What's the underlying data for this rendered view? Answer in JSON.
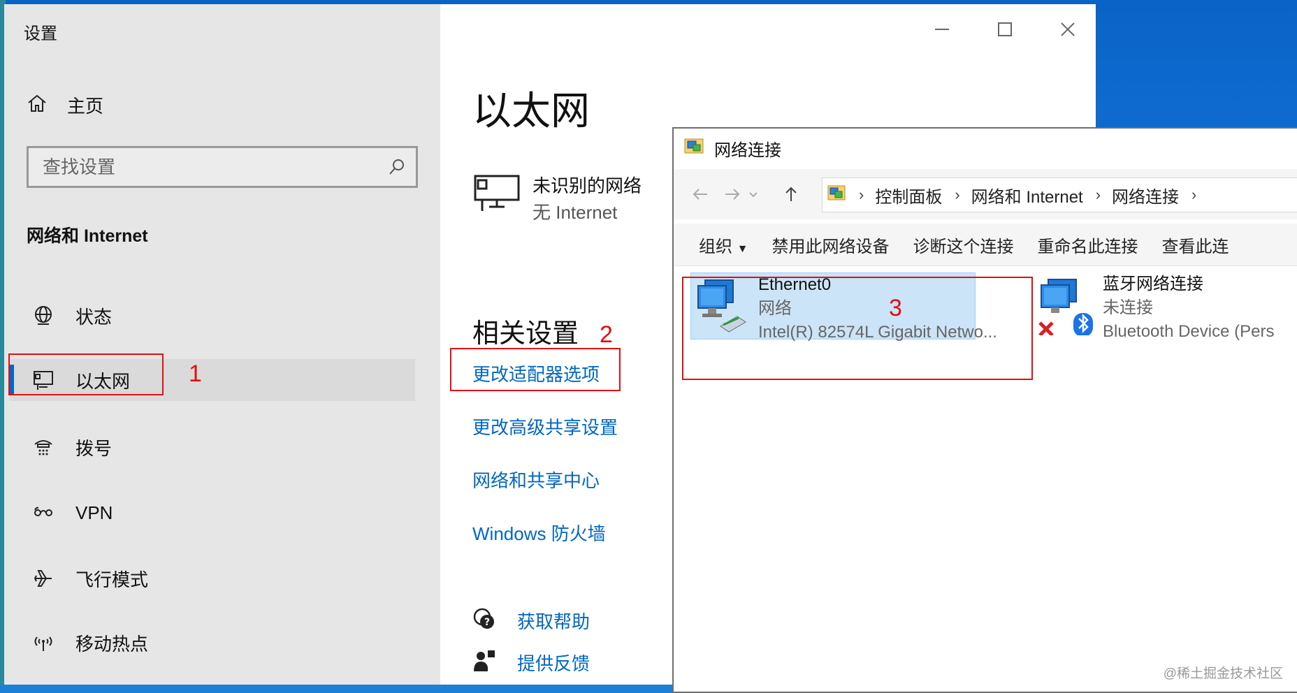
{
  "settings": {
    "window_title": "设置",
    "home_label": "主页",
    "search_placeholder": "查找设置",
    "section_heading": "网络和 Internet",
    "nav_items": [
      {
        "label": "状态",
        "icon": "globe-icon"
      },
      {
        "label": "以太网",
        "icon": "ethernet-monitor-icon",
        "active": true
      },
      {
        "label": "拨号",
        "icon": "dialup-icon"
      },
      {
        "label": "VPN",
        "icon": "vpn-icon"
      },
      {
        "label": "飞行模式",
        "icon": "airplane-icon"
      },
      {
        "label": "移动热点",
        "icon": "hotspot-icon"
      }
    ],
    "page_title": "以太网",
    "network": {
      "name": "未识别的网络",
      "status": "无 Internet"
    },
    "related_heading": "相关设置",
    "links": [
      "更改适配器选项",
      "更改高级共享设置",
      "网络和共享中心",
      "Windows 防火墙"
    ],
    "help": {
      "get_help": "获取帮助",
      "feedback": "提供反馈"
    },
    "caption_buttons": [
      "minimize",
      "maximize",
      "close"
    ]
  },
  "network_connections": {
    "title": "网络连接",
    "breadcrumb": [
      "控制面板",
      "网络和 Internet",
      "网络连接"
    ],
    "commands": [
      "组织",
      "禁用此网络设备",
      "诊断这个连接",
      "重命名此连接",
      "查看此连"
    ],
    "items": [
      {
        "name": "Ethernet0",
        "type": "网络",
        "device": "Intel(R) 82574L Gigabit Netwo...",
        "selected": true
      },
      {
        "name": "蓝牙网络连接",
        "type": "未连接",
        "device": "Bluetooth Device (Pers"
      }
    ]
  },
  "annotations": [
    "1",
    "2",
    "3"
  ],
  "watermark": "@稀土掘金技术社区",
  "colors": {
    "accent": "#0067c0",
    "annotation": "#e01010",
    "selection": "#cce4f7"
  }
}
